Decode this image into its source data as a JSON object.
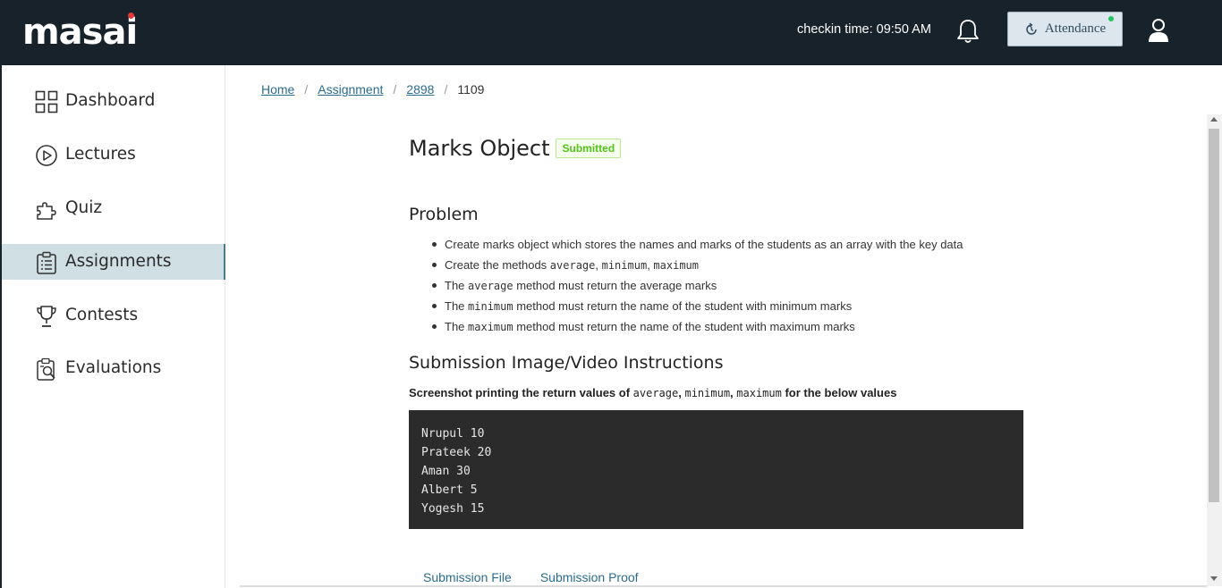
{
  "header": {
    "logo_text": "masai",
    "checkin_text": "checkin time: 09:50 AM",
    "attendance_label": "Attendance",
    "icons": {
      "bell": "bell-icon",
      "attendance": "clock-refresh-icon",
      "user": "user-icon"
    },
    "colors": {
      "bar": "#18222b",
      "logo_dot": "#e53935",
      "live_dot": "#22c55e"
    }
  },
  "sidebar": {
    "items": [
      {
        "label": "Dashboard",
        "icon": "grid-icon",
        "active": false
      },
      {
        "label": "Lectures",
        "icon": "play-circle-icon",
        "active": false
      },
      {
        "label": "Quiz",
        "icon": "puzzle-icon",
        "active": false
      },
      {
        "label": "Assignments",
        "icon": "clipboard-icon",
        "active": true
      },
      {
        "label": "Contests",
        "icon": "trophy-icon",
        "active": false
      },
      {
        "label": "Evaluations",
        "icon": "evaluation-icon",
        "active": false
      }
    ]
  },
  "breadcrumb": {
    "home": "Home",
    "assignment": "Assignment",
    "id1": "2898",
    "current": "1109",
    "separator": "/"
  },
  "assignment": {
    "title": "Marks Object",
    "status": "Submitted"
  },
  "problem": {
    "heading": "Problem",
    "b1": "Create marks object which stores the names and marks of the students as an array with the key data",
    "b2_pre": "Create the methods ",
    "b2_m1": "average",
    "b2_m2": "minimum",
    "b2_m3": "maximum",
    "b3_pre": "The ",
    "b3_code": "average",
    "b3_post": " method must return the average marks",
    "b4_pre": "The ",
    "b4_code": "minimum",
    "b4_post": " method must return the name of the student with minimum marks",
    "b5_pre": "The ",
    "b5_code": "maximum",
    "b5_post": " method must return the name of the student with maximum marks"
  },
  "submission": {
    "heading": "Submission Image/Video Instructions",
    "instr_pre": "Screenshot printing the return values of ",
    "instr_m1": "average",
    "instr_m2": "minimum",
    "instr_m3": "maximum",
    "instr_post": " for the below values",
    "code_lines": [
      "Nrupul 10",
      "Prateek 20",
      "Aman 30",
      "Albert 5",
      "Yogesh 15"
    ]
  },
  "tabs": {
    "file": "Submission File",
    "proof": "Submission Proof"
  }
}
